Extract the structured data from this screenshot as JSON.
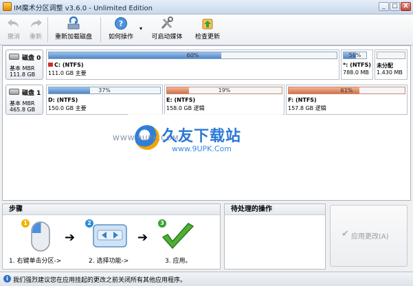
{
  "window": {
    "title": "IM魔术分区调整 v3.6.0 - Unlimited Edition",
    "minimize": "_",
    "maximize": "□",
    "close": "X"
  },
  "toolbar": {
    "undo": "撤消",
    "redo": "重新",
    "reload": "重新加载磁盘",
    "howto": "如何操作",
    "bootable": "可启动媒体",
    "update": "检查更新",
    "dropdown_arrow": "▾"
  },
  "disks": [
    {
      "name": "磁盘 0",
      "type": "基本 MBR",
      "size": "111.8 GB",
      "partitions": [
        {
          "label": "C: (NTFS)",
          "size": "111.0 GB 主要",
          "used_pct": 60,
          "pct_text": "60%",
          "color": "blue",
          "flag": true
        },
        {
          "label": "*: (NTFS)",
          "size": "788.0 MB",
          "used_pct": 56,
          "pct_text": "56%",
          "color": "blue"
        },
        {
          "label": "未分配",
          "size": "1.430 MB",
          "used_pct": 0,
          "pct_text": "",
          "color": "gray"
        }
      ]
    },
    {
      "name": "磁盘 1",
      "type": "基本 MBR",
      "size": "465.8 GB",
      "partitions": [
        {
          "label": "D: (NTFS)",
          "size": "150.0 GB 主要",
          "used_pct": 37,
          "pct_text": "37%",
          "color": "blue"
        },
        {
          "label": "E: (NTFS)",
          "size": "158.0 GB 逻辑",
          "used_pct": 19,
          "pct_text": "19%",
          "color": "orange"
        },
        {
          "label": "F: (NTFS)",
          "size": "157.8 GB 逻辑",
          "used_pct": 61,
          "pct_text": "61%",
          "color": "orange"
        }
      ]
    }
  ],
  "watermark": {
    "url1": "WWW.9UPK.COM",
    "brand": "久友下载站",
    "url2": "www.9UPK.Com"
  },
  "steps": {
    "title": "步骤",
    "items": [
      {
        "num": "1",
        "label": "1. 右键单击分区->",
        "color": "#f0b400"
      },
      {
        "num": "2",
        "label": "2. 选择功能->",
        "color": "#2e8bd8"
      },
      {
        "num": "3",
        "label": "3. 应用。",
        "color": "#3aa13a"
      }
    ],
    "arrow": "➔"
  },
  "pending": {
    "title": "待处理的操作"
  },
  "apply": {
    "label": "应用更改(A)",
    "check": "✔"
  },
  "status": {
    "text": "我们强烈建议您在应用挂起的更改之前关闭所有其他应用程序。",
    "icon": "i"
  }
}
